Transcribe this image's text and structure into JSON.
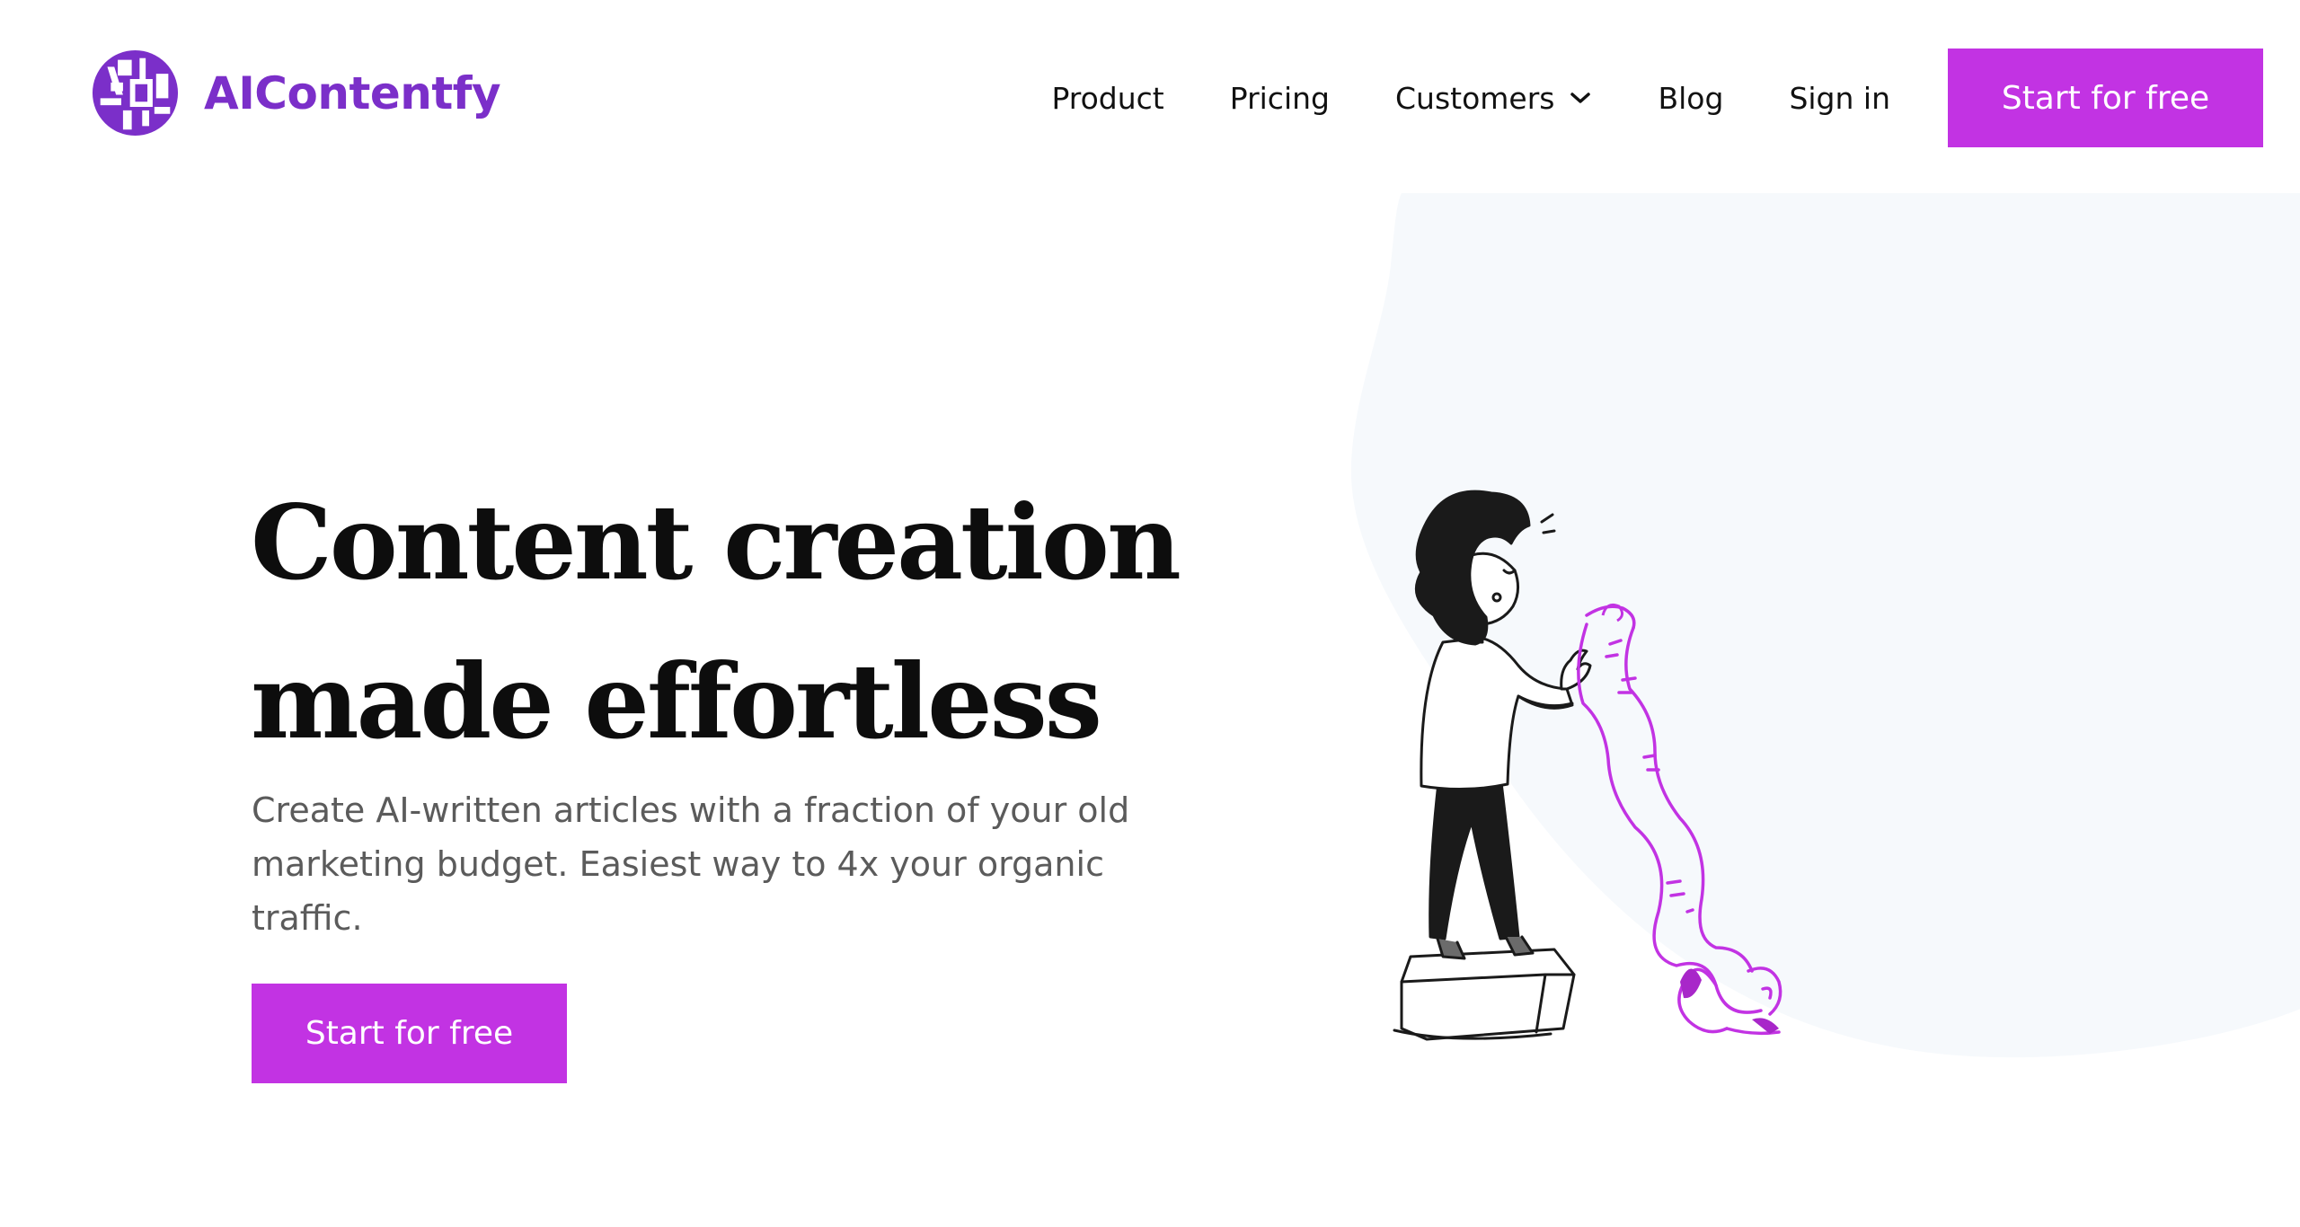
{
  "colors": {
    "accent": "#c233e3",
    "brand": "#7b2fc9",
    "hero_bg": "#f6f9fc"
  },
  "header": {
    "logo": {
      "text": "AIContentfy",
      "icon": "aicontentfy-logo-icon"
    },
    "nav": {
      "product": "Product",
      "pricing": "Pricing",
      "customers": "Customers",
      "customers_icon": "chevron-down-icon",
      "blog": "Blog",
      "sign_in": "Sign in"
    },
    "cta": "Start for free"
  },
  "hero": {
    "title_line1": "Content creation",
    "title_line2": "made effortless",
    "subtitle": "Create AI-written articles with a fraction of your old marketing budget. Easiest way to 4x your organic traffic.",
    "cta": "Start for free",
    "illustration": "woman-reading-long-scroll-illustration"
  }
}
